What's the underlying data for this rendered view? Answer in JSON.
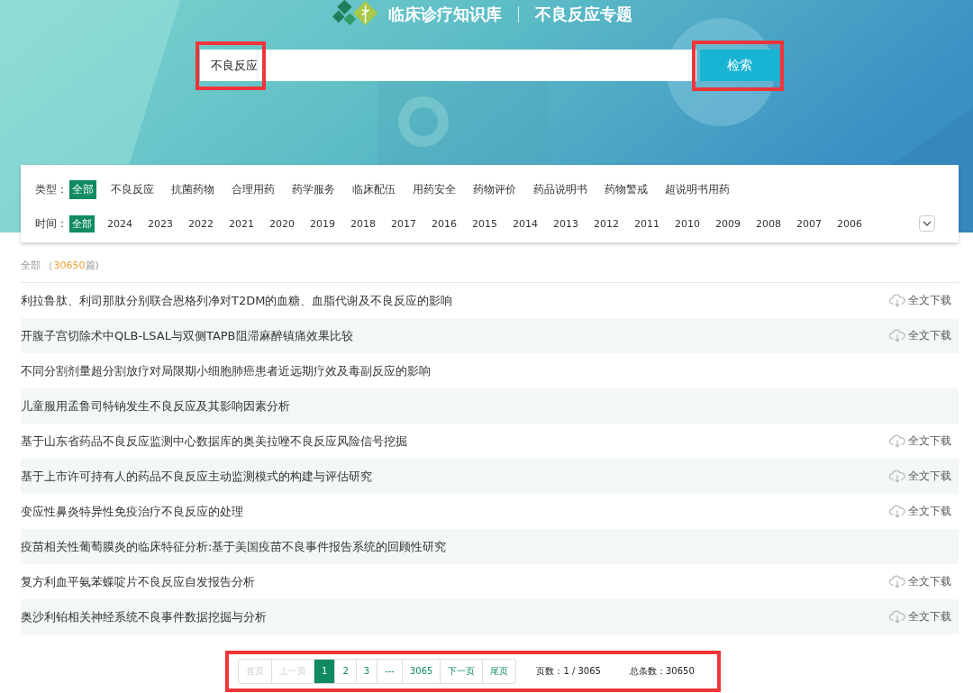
{
  "header": {
    "site_title": "临床诊疗知识库",
    "topic_title": "不良反应专题"
  },
  "search": {
    "value": "不良反应",
    "button": "检索"
  },
  "filters": [
    {
      "label": "类型：",
      "options": [
        {
          "text": "全部",
          "selected": true
        },
        {
          "text": "不良反应",
          "selected": false
        },
        {
          "text": "抗菌药物",
          "selected": false
        },
        {
          "text": "合理用药",
          "selected": false
        },
        {
          "text": "药学服务",
          "selected": false
        },
        {
          "text": "临床配伍",
          "selected": false
        },
        {
          "text": "用药安全",
          "selected": false
        },
        {
          "text": "药物评价",
          "selected": false
        },
        {
          "text": "药品说明书",
          "selected": false
        },
        {
          "text": "药物警戒",
          "selected": false
        },
        {
          "text": "超说明书用药",
          "selected": false
        }
      ]
    },
    {
      "label": "时间：",
      "options": [
        {
          "text": "全部",
          "selected": true
        },
        {
          "text": "2024",
          "selected": false
        },
        {
          "text": "2023",
          "selected": false
        },
        {
          "text": "2022",
          "selected": false
        },
        {
          "text": "2021",
          "selected": false
        },
        {
          "text": "2020",
          "selected": false
        },
        {
          "text": "2019",
          "selected": false
        },
        {
          "text": "2018",
          "selected": false
        },
        {
          "text": "2017",
          "selected": false
        },
        {
          "text": "2016",
          "selected": false
        },
        {
          "text": "2015",
          "selected": false
        },
        {
          "text": "2014",
          "selected": false
        },
        {
          "text": "2013",
          "selected": false
        },
        {
          "text": "2012",
          "selected": false
        },
        {
          "text": "2011",
          "selected": false
        },
        {
          "text": "2010",
          "selected": false
        },
        {
          "text": "2009",
          "selected": false
        },
        {
          "text": "2008",
          "selected": false
        },
        {
          "text": "2007",
          "selected": false
        },
        {
          "text": "2006",
          "selected": false
        }
      ],
      "expand": true
    }
  ],
  "results_summary": {
    "label": "全部",
    "open": "（",
    "count": "30650",
    "unit": "篇)"
  },
  "results": [
    {
      "title": "利拉鲁肽、利司那肽分别联合恩格列净对T2DM的血糖、血脂代谢及不良反应的影响",
      "download": "全文下载"
    },
    {
      "title": "开腹子宫切除术中QLB-LSAL与双侧TAPB阻滞麻醉镇痛效果比较",
      "download": "全文下载"
    },
    {
      "title": "不同分割剂量超分割放疗对局限期小细胞肺癌患者近远期疗效及毒副反应的影响"
    },
    {
      "title": "儿童服用孟鲁司特钠发生不良反应及其影响因素分析"
    },
    {
      "title": "基于山东省药品不良反应监测中心数据库的奥美拉唑不良反应风险信号挖掘",
      "download": "全文下载"
    },
    {
      "title": "基于上市许可持有人的药品不良反应主动监测模式的构建与评估研究",
      "download": "全文下载"
    },
    {
      "title": "变应性鼻炎特异性免疫治疗不良反应的处理",
      "download": "全文下载"
    },
    {
      "title": "疫苗相关性葡萄膜炎的临床特征分析:基于美国疫苗不良事件报告系统的回顾性研究"
    },
    {
      "title": "复方利血平氨苯蝶啶片不良反应自发报告分析",
      "download": "全文下载"
    },
    {
      "title": "奥沙利铂相关神经系统不良事件数据挖掘与分析",
      "download": "全文下载"
    }
  ],
  "pagination": {
    "pages": [
      {
        "text": "首页",
        "disabled": true,
        "selected": false
      },
      {
        "text": "上一页",
        "disabled": true,
        "selected": false
      },
      {
        "text": "1",
        "disabled": false,
        "selected": true
      },
      {
        "text": "2",
        "disabled": false,
        "selected": false
      },
      {
        "text": "3",
        "disabled": false,
        "selected": false
      },
      {
        "text": "---",
        "disabled": false,
        "selected": false
      },
      {
        "text": "3065",
        "disabled": false,
        "selected": false
      },
      {
        "text": "下一页",
        "disabled": false,
        "selected": false
      },
      {
        "text": "尾页",
        "disabled": false,
        "selected": false
      }
    ],
    "page_info": "页数：1 / 3065",
    "total": "总条数：30650"
  }
}
